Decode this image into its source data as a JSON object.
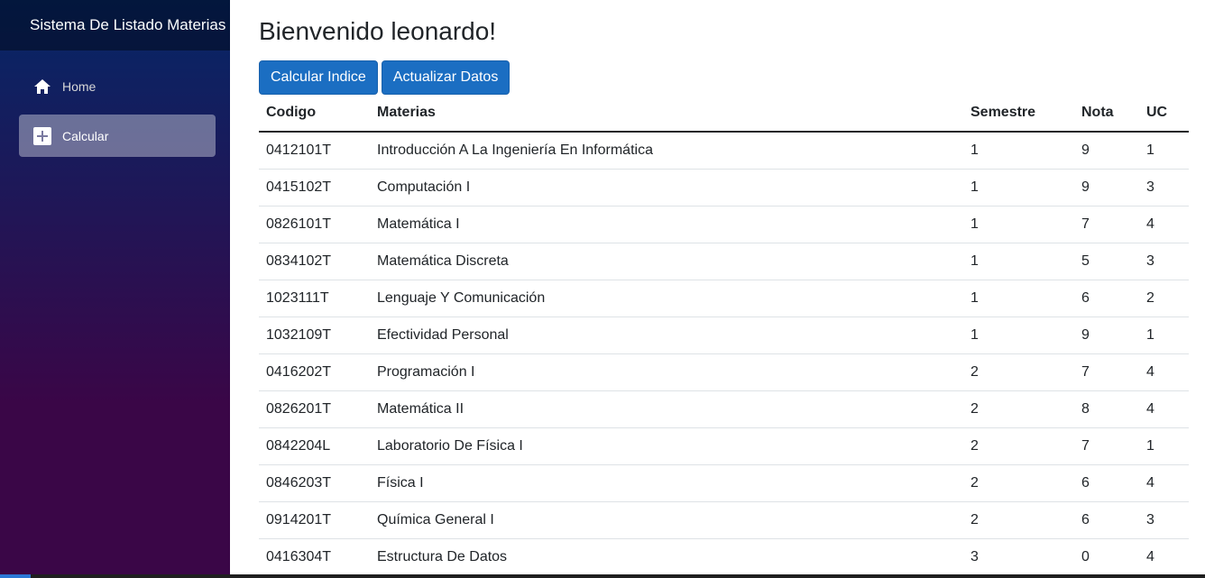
{
  "sidebar": {
    "brand": "Sistema De Listado Materias",
    "items": [
      {
        "label": "Home",
        "icon": "home-icon",
        "active": false
      },
      {
        "label": "Calcular",
        "icon": "plus-icon",
        "active": true
      }
    ]
  },
  "main": {
    "title": "Bienvenido leonardo!",
    "buttons": {
      "calcular": "Calcular Indice",
      "actualizar": "Actualizar Datos"
    },
    "table": {
      "headers": [
        "Codigo",
        "Materias",
        "Semestre",
        "Nota",
        "UC"
      ],
      "rows": [
        [
          "0412101T",
          "Introducción A La Ingeniería En Informática",
          "1",
          "9",
          "1"
        ],
        [
          "0415102T",
          "Computación I",
          "1",
          "9",
          "3"
        ],
        [
          "0826101T",
          "Matemática I",
          "1",
          "7",
          "4"
        ],
        [
          "0834102T",
          "Matemática Discreta",
          "1",
          "5",
          "3"
        ],
        [
          "1023111T",
          "Lenguaje Y Comunicación",
          "1",
          "6",
          "2"
        ],
        [
          "1032109T",
          "Efectividad Personal",
          "1",
          "9",
          "1"
        ],
        [
          "0416202T",
          "Programación I",
          "2",
          "7",
          "4"
        ],
        [
          "0826201T",
          "Matemática II",
          "2",
          "8",
          "4"
        ],
        [
          "0842204L",
          "Laboratorio De Física I",
          "2",
          "7",
          "1"
        ],
        [
          "0846203T",
          "Física I",
          "2",
          "6",
          "4"
        ],
        [
          "0914201T",
          "Química General I",
          "2",
          "6",
          "3"
        ],
        [
          "0416304T",
          "Estructura De Datos",
          "3",
          "0",
          "4"
        ]
      ]
    }
  },
  "colors": {
    "primary_button": "#1b6ec2",
    "sidebar_top": "#052767",
    "sidebar_bottom": "#3a0647"
  }
}
